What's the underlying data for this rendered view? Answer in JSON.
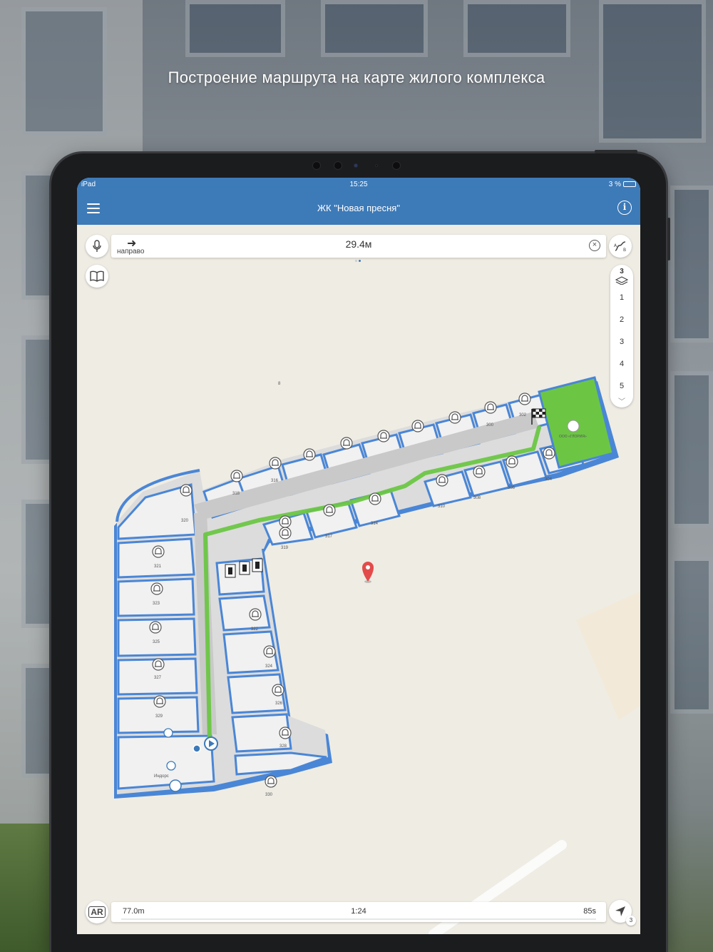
{
  "headline": "Построение маршрута на карте жилого комплекса",
  "status_bar": {
    "device": "iPad",
    "time": "15:25",
    "battery": "3 %"
  },
  "nav": {
    "title": "ЖК  \"Новая пресня\"",
    "menu_icon": "hamburger-icon",
    "info_icon": "info-icon"
  },
  "route": {
    "direction_icon": "arrow-right-icon",
    "direction_text": "направо",
    "distance": "29.4м",
    "close_icon": "close-circle-icon"
  },
  "buttons": {
    "mic_icon": "microphone-icon",
    "book_icon": "book-icon",
    "route_icon": "route-ab-icon",
    "ar_label": "AR",
    "locate_icon": "locate-arrow-icon",
    "locate_badge": "3"
  },
  "floors": {
    "current": "3",
    "items": [
      "1",
      "2",
      "3",
      "4",
      "5"
    ],
    "more": "﹀"
  },
  "map": {
    "outside_label": "8",
    "rooms": {
      "r300": "300",
      "r302": "302",
      "r304": "304",
      "r306": "306",
      "r308": "308",
      "r310": "310",
      "r314": "314",
      "r316": "316",
      "r317": "317",
      "r318": "318",
      "r319": "319",
      "r320": "320",
      "r321": "321",
      "r322": "322",
      "r323": "323",
      "r324": "324",
      "r325": "325",
      "r326": "326",
      "r327": "327",
      "r328": "328",
      "r329": "329",
      "r330": "330"
    },
    "destination_label": "ООО «ГЛОРИЯ»",
    "poi_label": "Индорс"
  },
  "bottom": {
    "distance": "77.0m",
    "time": "1:24",
    "seconds": "85s",
    "progress": 0.0
  },
  "colors": {
    "nav_blue": "#3d7ab8",
    "route_green": "#6cc644",
    "wall_blue": "#4a86d6",
    "floor_gray": "#d8d8d8"
  }
}
